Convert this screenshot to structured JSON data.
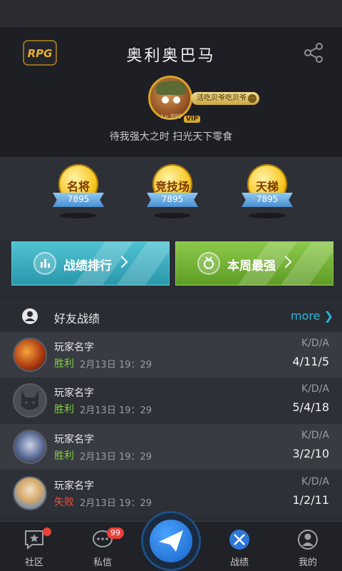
{
  "header": {
    "logo_text": "RPG",
    "title": "奥利奥巴马",
    "nickname_tag": "活吃贝爷吃贝爷",
    "level": "Lv.999",
    "vip": "VIP",
    "motto": "待我强大之时 扫光天下零食"
  },
  "badges": [
    {
      "name": "名将",
      "value": "7895"
    },
    {
      "name": "竞技场",
      "value": "7895"
    },
    {
      "name": "天梯",
      "value": "7895"
    }
  ],
  "actions": {
    "rank_label": "战绩排行",
    "weekly_label": "本周最强"
  },
  "friends": {
    "title": "好友战绩",
    "more": "more",
    "rows": [
      {
        "name": "玩家名字",
        "result": "胜利",
        "result_type": "win",
        "time": "2月13日 19：29",
        "kda_label": "K/D/A",
        "kda": "4/11/5"
      },
      {
        "name": "玩家名字",
        "result": "胜利",
        "result_type": "win",
        "time": "2月13日 19：29",
        "kda_label": "K/D/A",
        "kda": "5/4/18"
      },
      {
        "name": "玩家名字",
        "result": "胜利",
        "result_type": "win",
        "time": "2月13日 19：29",
        "kda_label": "K/D/A",
        "kda": "3/2/10"
      },
      {
        "name": "玩家名字",
        "result": "失败",
        "result_type": "loss",
        "time": "2月13日 19：29",
        "kda_label": "K/D/A",
        "kda": "1/2/11"
      }
    ]
  },
  "tabbar": {
    "community": "社区",
    "messages": "私信",
    "messages_badge": "99",
    "stats": "战绩",
    "me": "我的"
  },
  "colors": {
    "accent": "#27b6d9",
    "win": "#7ed23d",
    "loss": "#f0503c",
    "badge_red": "#e8403a"
  }
}
